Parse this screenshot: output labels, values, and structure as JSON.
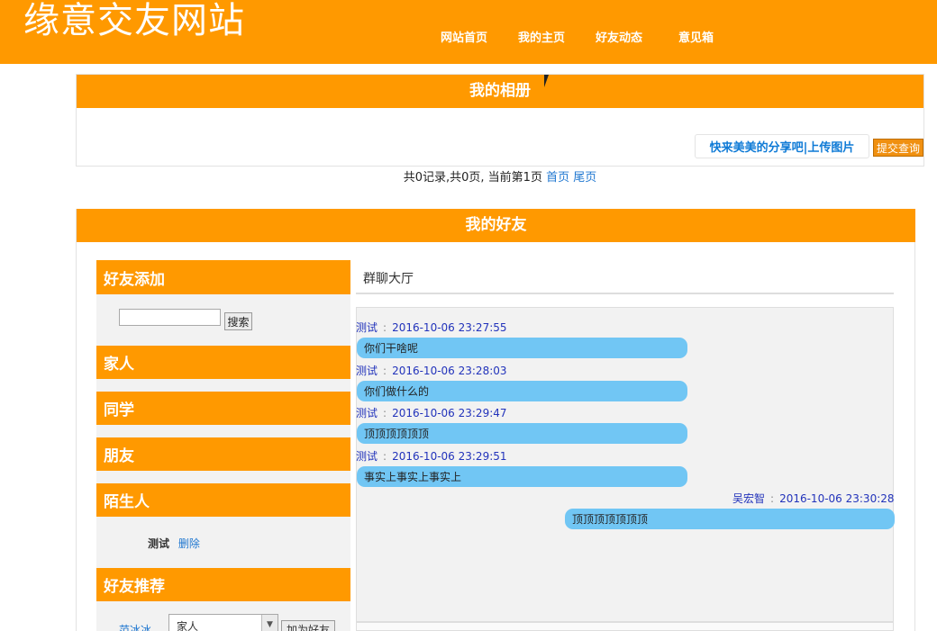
{
  "header": {
    "site_title": "缘意交友网站",
    "nav": [
      "网站首页",
      "我的主页",
      "好友动态",
      "意见箱"
    ]
  },
  "album": {
    "title": "我的相册",
    "upload_label": "快来美美的分享吧|上传图片",
    "submit_label": "提交查询"
  },
  "pager": {
    "summary": "共0记录,共0页, 当前第1页",
    "first": "首页",
    "last": "尾页"
  },
  "friends": {
    "title": "我的好友",
    "sidebar": {
      "add_heading": "好友添加",
      "search_value": "",
      "search_button": "搜索",
      "groups": [
        "家人",
        "同学",
        "朋友",
        "陌生人"
      ],
      "stranger_friend": {
        "name": "测试",
        "delete_label": "删除"
      },
      "recommend_heading": "好友推荐",
      "recommend_name": "范冰冰",
      "group_select_value": "家人",
      "add_friend_button": "加为好友"
    },
    "chat": {
      "title": "群聊大厅",
      "messages": [
        {
          "sender": "测试",
          "time": "2016-10-06 23:27:55",
          "text": "你们干啥呢"
        },
        {
          "sender": "测试",
          "time": "2016-10-06 23:28:03",
          "text": "你们做什么的"
        },
        {
          "sender": "测试",
          "time": "2016-10-06 23:29:47",
          "text": "顶顶顶顶顶顶"
        },
        {
          "sender": "测试",
          "time": "2016-10-06 23:29:51",
          "text": "事实上事实上事实上"
        },
        {
          "sender": "吴宏智",
          "time": "2016-10-06 23:30:28",
          "text": "顶顶顶顶顶顶顶"
        }
      ]
    }
  },
  "colors": {
    "accent": "#ff9900",
    "bubble": "#71c6f4",
    "link": "#1f77d0"
  }
}
